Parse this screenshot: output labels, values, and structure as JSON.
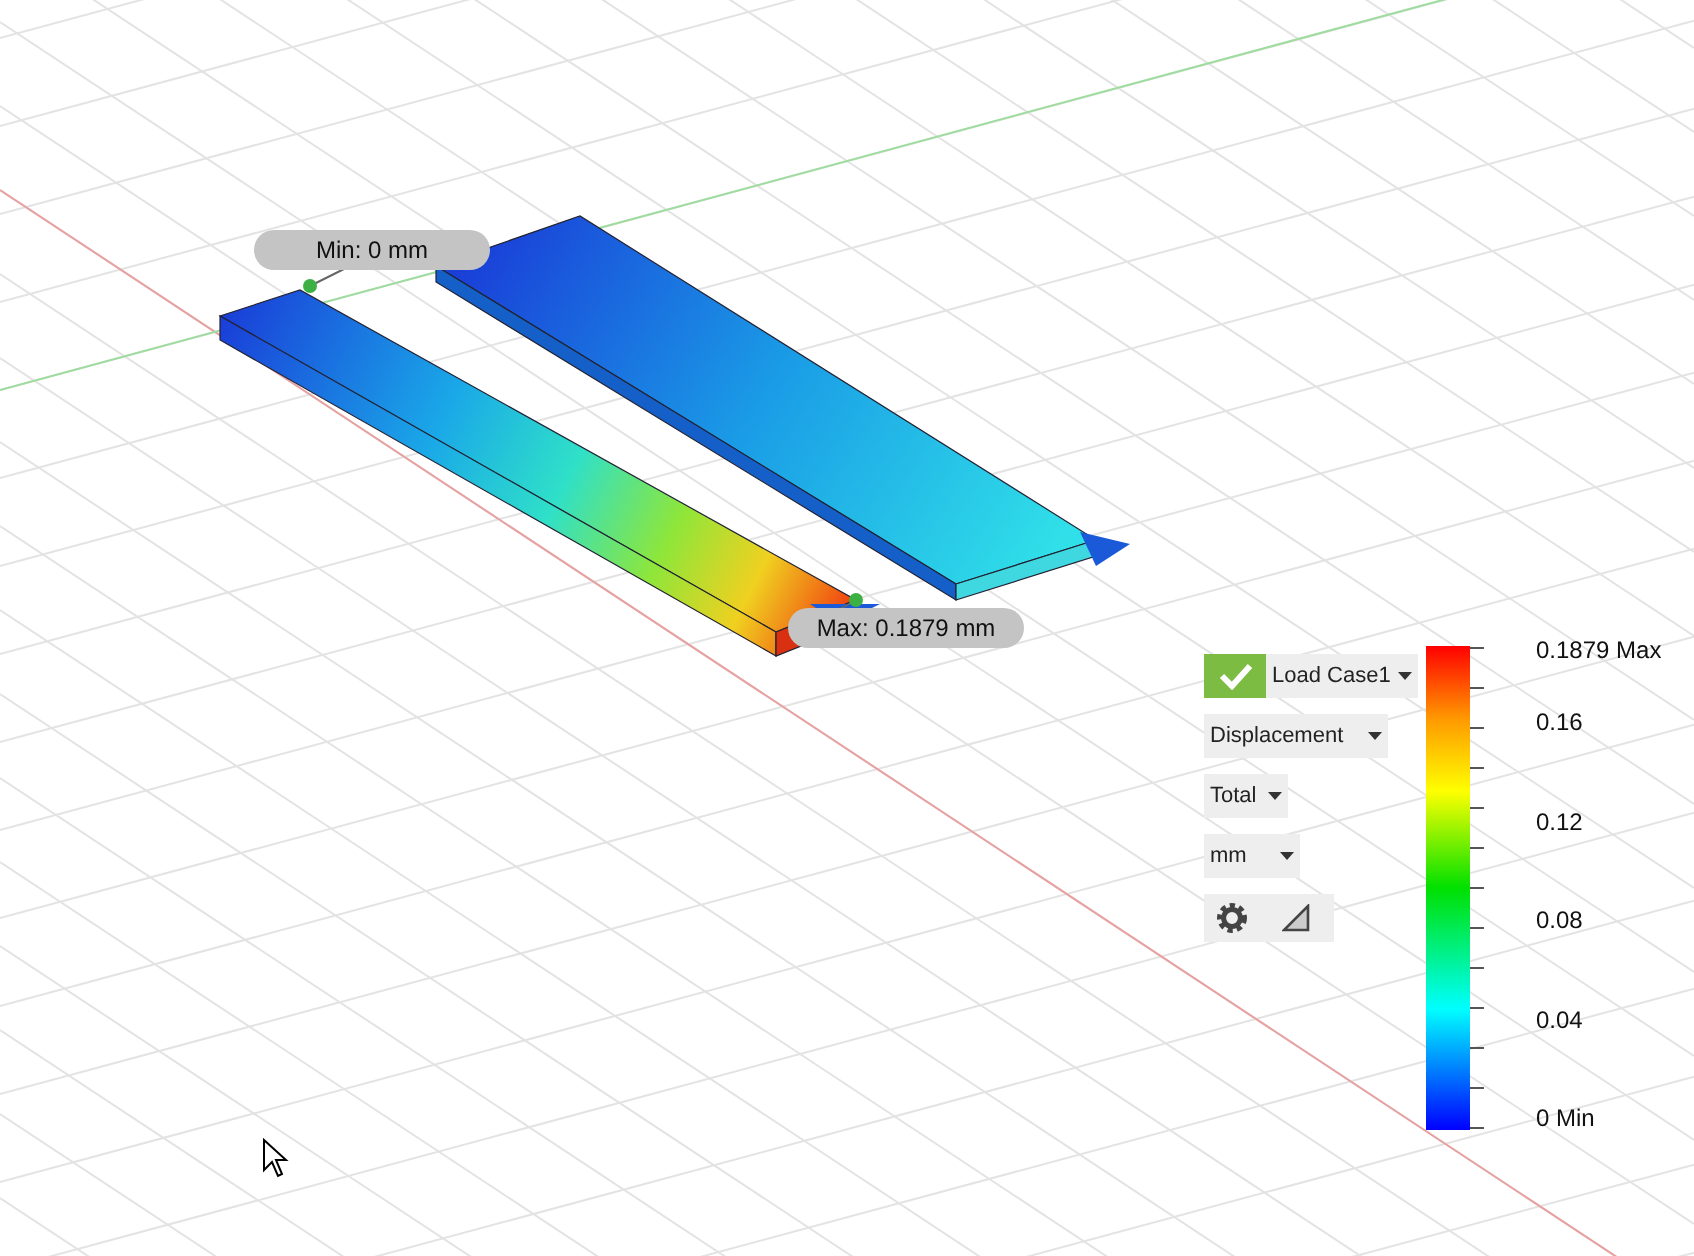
{
  "viewport": {
    "labels": [
      {
        "kind": "min",
        "text": "Min: 0 mm"
      },
      {
        "kind": "max",
        "text": "Max: 0.1879 mm"
      }
    ]
  },
  "legend": {
    "load_case": {
      "label": "Load Case1",
      "checked": true
    },
    "dropdowns": [
      "Displacement",
      "Total",
      "mm"
    ],
    "scale_labels": [
      "0.1879 Max",
      "0.16",
      "0.12",
      "0.08",
      "0.04",
      "0 Min"
    ]
  }
}
